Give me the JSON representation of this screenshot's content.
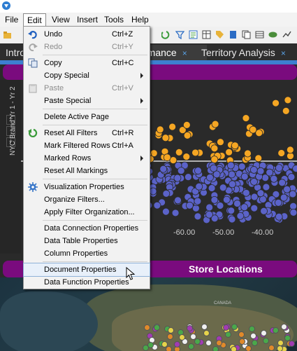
{
  "menubar": {
    "items": [
      "File",
      "Edit",
      "View",
      "Insert",
      "Tools",
      "Help"
    ],
    "active": "Edit"
  },
  "tabs": [
    {
      "label": "Intro"
    },
    {
      "label": "rmance",
      "close": "×"
    },
    {
      "label": "Territory Analysis",
      "close": "×"
    }
  ],
  "visualization": {
    "y_axis_title": "NYC Brand Yr 1 - Yr 2",
    "x_ticks": [
      "-60.00",
      "-50.00",
      "-40.00"
    ],
    "left_buttons": [
      "+",
      "-",
      "+"
    ]
  },
  "store_locations": {
    "title": "Store Locations",
    "map_label": "CANADA"
  },
  "edit_menu": {
    "items": [
      {
        "label": "Undo",
        "shortcut": "Ctrl+Z",
        "icon": "undo-icon"
      },
      {
        "label": "Redo",
        "shortcut": "Ctrl+Y",
        "icon": "redo-icon",
        "disabled": true
      },
      {
        "label": "Copy",
        "shortcut": "Ctrl+C",
        "icon": "copy-icon"
      },
      {
        "label": "Copy Special",
        "submenu": true
      },
      {
        "label": "Paste",
        "shortcut": "Ctrl+V",
        "icon": "paste-icon",
        "disabled": true
      },
      {
        "label": "Paste Special",
        "submenu": true
      },
      {
        "label": "Delete Active Page"
      },
      {
        "label": "Reset All Filters",
        "shortcut": "Ctrl+R",
        "icon": "reset-filters-icon"
      },
      {
        "label": "Mark Filtered Rows",
        "shortcut": "Ctrl+A"
      },
      {
        "label": "Marked Rows",
        "submenu": true
      },
      {
        "label": "Reset All Markings"
      },
      {
        "label": "Visualization Properties",
        "icon": "gear-icon"
      },
      {
        "label": "Organize Filters..."
      },
      {
        "label": "Apply Filter Organization..."
      },
      {
        "label": "Data Connection Properties"
      },
      {
        "label": "Data Table Properties"
      },
      {
        "label": "Column Properties"
      },
      {
        "label": "Document Properties",
        "highlighted": true
      },
      {
        "label": "Data Function Properties"
      }
    ]
  },
  "colors": {
    "accent_purple": "#7a0b7e",
    "orange_points": "#f5a623",
    "blue_points": "#5b63c9"
  }
}
